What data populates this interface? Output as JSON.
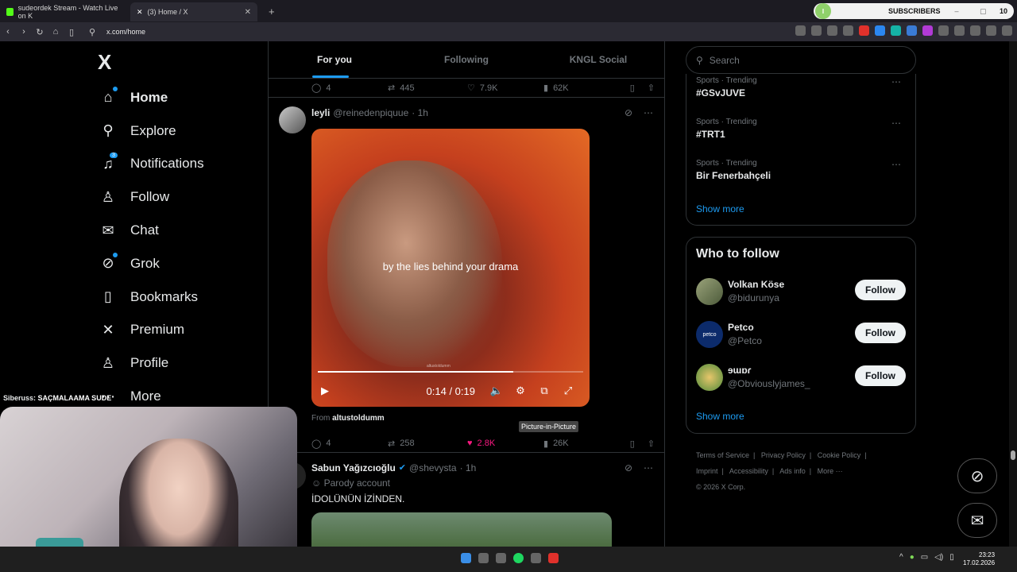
{
  "browser": {
    "tabs": [
      {
        "label": "sudeordek Stream - Watch Live on K",
        "color": "#53fc18"
      },
      {
        "label": "(3) Home / X",
        "color": "#ffffff"
      }
    ],
    "url": "x.com/home",
    "subscribers": {
      "label": "SUBSCRIBERS",
      "count": "10"
    }
  },
  "nav": {
    "logo": "X",
    "items": [
      {
        "label": "Home",
        "icon": "home-icon"
      },
      {
        "label": "Explore",
        "icon": "search-icon"
      },
      {
        "label": "Notifications",
        "icon": "bell-icon",
        "badge": "3"
      },
      {
        "label": "Follow",
        "icon": "follow-icon"
      },
      {
        "label": "Chat",
        "icon": "mail-icon"
      },
      {
        "label": "Grok",
        "icon": "grok-icon"
      },
      {
        "label": "Bookmarks",
        "icon": "bookmark-icon"
      },
      {
        "label": "Premium",
        "icon": "x-icon"
      },
      {
        "label": "Profile",
        "icon": "profile-icon"
      },
      {
        "label": "More",
        "icon": "more-icon"
      }
    ]
  },
  "feed": {
    "tabs": [
      "For you",
      "Following",
      "KNGL Social"
    ],
    "prev_post_actions": {
      "replies": "4",
      "reposts": "445",
      "likes": "7.9K",
      "views": "62K"
    },
    "post1": {
      "name": "leyli",
      "handle": "@reinedenpiquue",
      "time": "· 1h",
      "subtitle": "by the lies behind your drama",
      "watermark": "altustoldumm",
      "progress": 0.737,
      "time_display": "0:14 / 0:19",
      "tooltip": "Picture-in-Picture",
      "from_label": "From",
      "from_user": "altustoldumm",
      "replies": "4",
      "reposts": "258",
      "likes": "2.8K",
      "views": "26K"
    },
    "post2": {
      "name": "Sabun Yağızcıoğlu",
      "handle": "@shevysta",
      "time": "· 1h",
      "parody": "Parody account",
      "text": "İDOLÜNÜN İZİNDEN."
    }
  },
  "right": {
    "search_placeholder": "Search",
    "trends": [
      {
        "category": "Sports · Trending",
        "tag": "#GSvJUVE"
      },
      {
        "category": "Sports · Trending",
        "tag": "#TRT1"
      },
      {
        "category": "Sports · Trending",
        "tag": "Bir Fenerbahçeli"
      }
    ],
    "trends_show_more": "Show more",
    "who_to_follow": {
      "title": "Who to follow",
      "accounts": [
        {
          "name": "Volkan Köse",
          "handle": "@bidurunya",
          "button": "Follow"
        },
        {
          "name": "Petco",
          "handle": "@Petco",
          "button": "Follow",
          "avatar_text": "petco"
        },
        {
          "name": "ɘɯɒɾ",
          "handle": "@Obviouslyjames_",
          "button": "Follow"
        }
      ],
      "show_more": "Show more"
    },
    "footer": [
      "Terms of Service",
      "|",
      "Privacy Policy",
      "|",
      "Cookie Policy",
      "|",
      "Imprint",
      "|",
      "Accessibility",
      "|",
      "Ads info",
      "|",
      "More ···",
      "© 2026 X Corp."
    ]
  },
  "stream": {
    "chat_user": "Siberuss",
    "chat_text": ": SAÇMALAAMA SUDE"
  },
  "taskbar": {
    "time": "23:23",
    "date": "17.02.2026"
  }
}
